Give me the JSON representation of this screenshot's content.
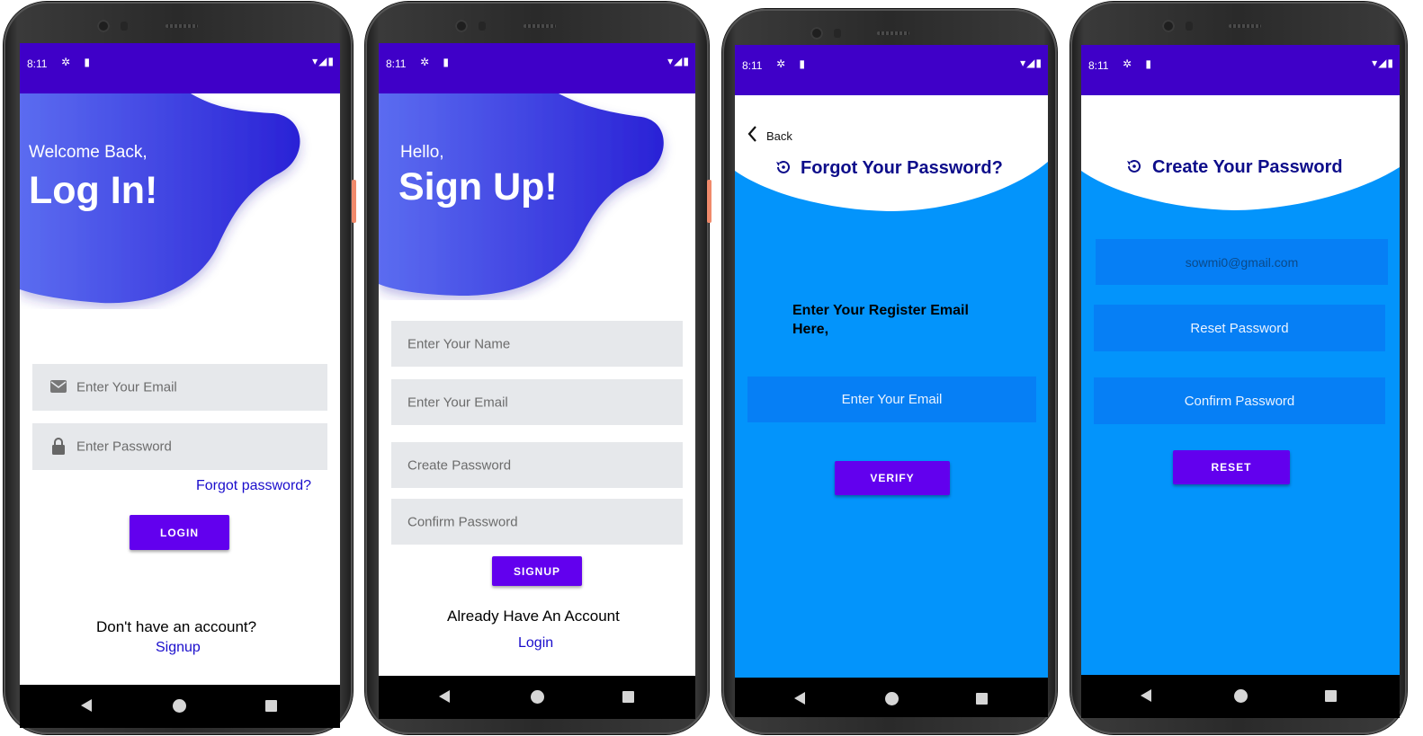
{
  "status_bar": {
    "time": "8:11",
    "left_icons": "✲ ▮",
    "right_icons": "▾◢▮"
  },
  "login_screen": {
    "greeting": "Welcome Back,",
    "title": "Log In!",
    "email_placeholder": "Enter Your Email",
    "password_placeholder": "Enter Password",
    "email_icon": "envelope-icon",
    "password_icon": "lock-icon",
    "forgot_link": "Forgot password?",
    "login_button": "LOGIN",
    "no_account_text": "Don't have an account?",
    "signup_link": "Signup"
  },
  "signup_screen": {
    "greeting": "Hello,",
    "title": "Sign Up!",
    "name_placeholder": "Enter Your Name",
    "email_placeholder": "Enter Your Email",
    "create_password_placeholder": "Create Password",
    "confirm_password_placeholder": "Confirm Password",
    "signup_button": "SIGNUP",
    "have_account_text": "Already Have An Account",
    "login_link": "Login"
  },
  "forgot_screen": {
    "back_label": "Back",
    "title": "Forgot Your Password?",
    "instruction_line1": "Enter Your Register Email",
    "instruction_line2": "Here,",
    "email_placeholder": "Enter Your Email",
    "verify_button": "VERIFY"
  },
  "reset_screen": {
    "title": "Create Your Password",
    "email_value": "sowmi0@gmail.com",
    "reset_password_placeholder": "Reset Password",
    "confirm_password_placeholder": "Confirm Password",
    "reset_button": "RESET"
  },
  "colors": {
    "status_bar": "#3f00c8",
    "button": "#6200ee",
    "blob_start": "#5b6cf0",
    "blob_end": "#2a22d6",
    "blue_panel": "#0394fb",
    "link": "#1a0dcc",
    "heading": "#0d0d8a"
  }
}
